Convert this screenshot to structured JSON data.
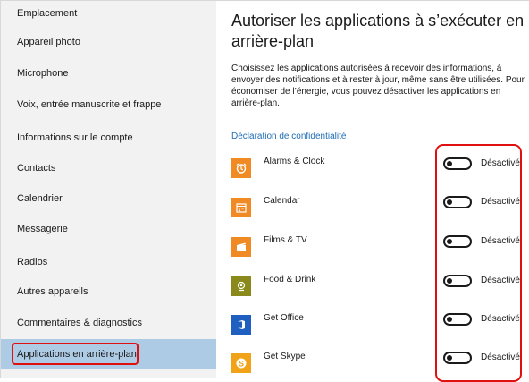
{
  "sidebar": {
    "items": [
      {
        "label": "Emplacement"
      },
      {
        "label": "Appareil photo"
      },
      {
        "label": "Microphone"
      },
      {
        "label": "Voix, entrée manuscrite et frappe"
      },
      {
        "label": "Informations sur le compte"
      },
      {
        "label": "Contacts"
      },
      {
        "label": "Calendrier"
      },
      {
        "label": "Messagerie"
      },
      {
        "label": "Radios"
      },
      {
        "label": "Autres appareils"
      },
      {
        "label": "Commentaires & diagnostics"
      },
      {
        "label": "Applications en arrière-plan",
        "selected": true
      }
    ]
  },
  "main": {
    "title": "Autoriser les applications à s’exécuter en arrière-plan",
    "description": "Choisissez les applications autorisées à recevoir des informations, à envoyer des notifications et à rester à jour, même sans être utilisées. Pour économiser de l’énergie, vous pouvez désactiver les applications en arrière-plan.",
    "privacy_link": "Déclaration de confidentialité",
    "apps": [
      {
        "name": "Alarms & Clock",
        "state": "Désactivé",
        "icon": "alarm-clock-icon",
        "color": "#f08a24"
      },
      {
        "name": "Calendar",
        "state": "Désactivé",
        "icon": "calendar-icon",
        "color": "#f08a24"
      },
      {
        "name": "Films & TV",
        "state": "Désactivé",
        "icon": "film-icon",
        "color": "#f08a24"
      },
      {
        "name": "Food & Drink",
        "state": "Désactivé",
        "icon": "food-icon",
        "color": "#8a8a1c"
      },
      {
        "name": "Get Office",
        "state": "Désactivé",
        "icon": "office-icon",
        "color": "#1f5fbf"
      },
      {
        "name": "Get Skype",
        "state": "Désactivé",
        "icon": "skype-icon",
        "color": "#f0a318"
      }
    ]
  },
  "colors": {
    "accent": "#1f6eb5",
    "sidebar_bg": "#f2f2f2",
    "selected_bg": "#aecbe6",
    "highlight": "#e01010"
  }
}
